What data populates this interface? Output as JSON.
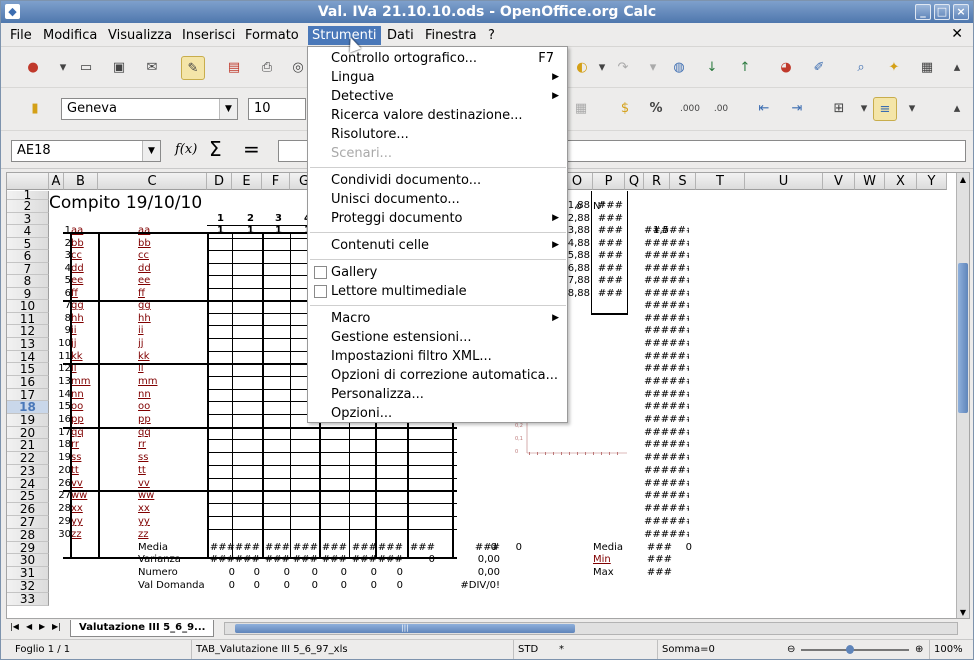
{
  "window": {
    "title": "Val. IVa 21.10.10.ods - OpenOffice.org Calc"
  },
  "menubar": {
    "items": [
      "File",
      "Modifica",
      "Visualizza",
      "Inserisci",
      "Formato",
      "Strumenti",
      "Dati",
      "Finestra",
      "?"
    ],
    "active": "Strumenti"
  },
  "format": {
    "font": "Geneva",
    "size": "10"
  },
  "formula": {
    "cell_ref": "AE18",
    "fx": "f(x)",
    "sum": "Σ",
    "eq": "="
  },
  "columns": [
    "A",
    "B",
    "C",
    "D",
    "E",
    "F",
    "G",
    "",
    "",
    "",
    "",
    "",
    "",
    "O",
    "P",
    "Q",
    "R",
    "S",
    "T",
    "U",
    "V",
    "W",
    "X",
    "Y"
  ],
  "rows": [
    "1",
    "2",
    "3",
    "4",
    "5",
    "6",
    "7",
    "8",
    "9",
    "10",
    "11",
    "12",
    "13",
    "14",
    "15",
    "16",
    "17",
    "18",
    "19",
    "20",
    "21",
    "22",
    "23",
    "24",
    "25",
    "26",
    "27",
    "28",
    "29",
    "30",
    "31",
    "32",
    "33"
  ],
  "selected_row": "18",
  "sheet": {
    "title": "Compito 19/10/10",
    "hdr_d": [
      "1",
      "1"
    ],
    "hdr_e": [
      "2",
      "1"
    ],
    "hdr_f": [
      "3",
      "1"
    ],
    "hdr_g": [
      "4",
      "1"
    ],
    "o_hdr": "o",
    "p_hdr": "N°",
    "o_vals": [
      "1,88",
      "2,88",
      "3,88",
      "4,88",
      "5,88",
      "6,88",
      "7,88",
      "8,88"
    ],
    "p_vals": [
      "###",
      "###",
      "###",
      "###",
      "###",
      "###",
      "###",
      "###"
    ],
    "r3": "1,5",
    "r_hashes": [
      "######",
      "######",
      "######",
      "######",
      "######",
      "######",
      "######",
      "######",
      "######",
      "######",
      "######",
      "######",
      "######",
      "######",
      "######",
      "######",
      "######",
      "######",
      "######",
      "######",
      "######",
      "######",
      "######",
      "######",
      "######"
    ],
    "students": [
      {
        "n": "1",
        "b": "aa",
        "c": "aa"
      },
      {
        "n": "2",
        "b": "bb",
        "c": "bb"
      },
      {
        "n": "3",
        "b": "cc",
        "c": "cc"
      },
      {
        "n": "4",
        "b": "dd",
        "c": "dd"
      },
      {
        "n": "5",
        "b": "ee",
        "c": "ee"
      },
      {
        "n": "6",
        "b": "ff",
        "c": "ff"
      },
      {
        "n": "7",
        "b": "gg",
        "c": "gg"
      },
      {
        "n": "8",
        "b": "hh",
        "c": "hh"
      },
      {
        "n": "9",
        "b": "ii",
        "c": "ii"
      },
      {
        "n": "10",
        "b": "jj",
        "c": "jj"
      },
      {
        "n": "11",
        "b": "kk",
        "c": "kk"
      },
      {
        "n": "12",
        "b": "ll",
        "c": "ll"
      },
      {
        "n": "13",
        "b": "mm",
        "c": "mm"
      },
      {
        "n": "14",
        "b": "nn",
        "c": "nn"
      },
      {
        "n": "15",
        "b": "oo",
        "c": "oo"
      },
      {
        "n": "16",
        "b": "pp",
        "c": "pp"
      },
      {
        "n": "17",
        "b": "qq",
        "c": "qq"
      },
      {
        "n": "18",
        "b": "rr",
        "c": "rr"
      },
      {
        "n": "19",
        "b": "ss",
        "c": "ss"
      },
      {
        "n": "20",
        "b": "tt",
        "c": "tt"
      },
      {
        "n": "26",
        "b": "vv",
        "c": "vv"
      },
      {
        "n": "27",
        "b": "ww",
        "c": "ww"
      },
      {
        "n": "28",
        "b": "xx",
        "c": "xx"
      },
      {
        "n": "29",
        "b": "yy",
        "c": "yy"
      },
      {
        "n": "30",
        "b": "zz",
        "c": "zz"
      }
    ],
    "summary": [
      {
        "label": "Media",
        "vals": [
          "###",
          "###",
          "###",
          "###",
          "###",
          "###",
          "###",
          "###",
          "###"
        ],
        "m": "0",
        "n": "0",
        "s_label": "Media",
        "s_val": "###",
        "s_extra": "0"
      },
      {
        "label": "Varianza",
        "vals": [
          "###",
          "###",
          "###",
          "###",
          "###",
          "###",
          "###",
          "0",
          "0,00"
        ],
        "m": "",
        "n": "",
        "s_label": "Min",
        "s_val": "###",
        "s_extra": ""
      },
      {
        "label": "Numero",
        "vals": [
          "0",
          "0",
          "0",
          "0",
          "0",
          "0",
          "0",
          "",
          "0,00"
        ],
        "m": "",
        "n": "",
        "s_label": "Max",
        "s_val": "###",
        "s_extra": ""
      },
      {
        "label": "Val Domanda",
        "vals": [
          "0",
          "0",
          "0",
          "0",
          "0",
          "0",
          "0",
          "",
          "#DIV/0!"
        ],
        "m": "",
        "n": "",
        "s_label": "",
        "s_val": "",
        "s_extra": ""
      }
    ]
  },
  "strumenti_menu": [
    {
      "label": "Controllo ortografico...",
      "shortcut": "F7"
    },
    {
      "label": "Lingua",
      "submenu": true
    },
    {
      "label": "Detective",
      "submenu": true
    },
    {
      "label": "Ricerca valore destinazione..."
    },
    {
      "label": "Risolutore..."
    },
    {
      "label": "Scenari...",
      "disabled": true
    },
    {
      "sep": true
    },
    {
      "label": "Condividi documento..."
    },
    {
      "label": "Unisci documento..."
    },
    {
      "label": "Proteggi documento",
      "submenu": true
    },
    {
      "sep": true
    },
    {
      "label": "Contenuti celle",
      "submenu": true
    },
    {
      "sep": true
    },
    {
      "label": "Gallery",
      "check": true
    },
    {
      "label": "Lettore multimediale",
      "check": true
    },
    {
      "sep": true
    },
    {
      "label": "Macro",
      "submenu": true
    },
    {
      "label": "Gestione estensioni..."
    },
    {
      "label": "Impostazioni filtro XML..."
    },
    {
      "label": "Opzioni di correzione automatica..."
    },
    {
      "label": "Personalizza..."
    },
    {
      "label": "Opzioni..."
    }
  ],
  "tabs": {
    "active": "Valutazione III 5_6_9..."
  },
  "status": {
    "sheet": "Foglio 1 / 1",
    "style": "TAB_Valutazione III 5_6_97_xls",
    "mode": "STD",
    "asterisk": "*",
    "sum": "Somma=0",
    "zoom": "100%"
  },
  "chart_ticks": [
    "0,2",
    "0,1",
    "0"
  ]
}
